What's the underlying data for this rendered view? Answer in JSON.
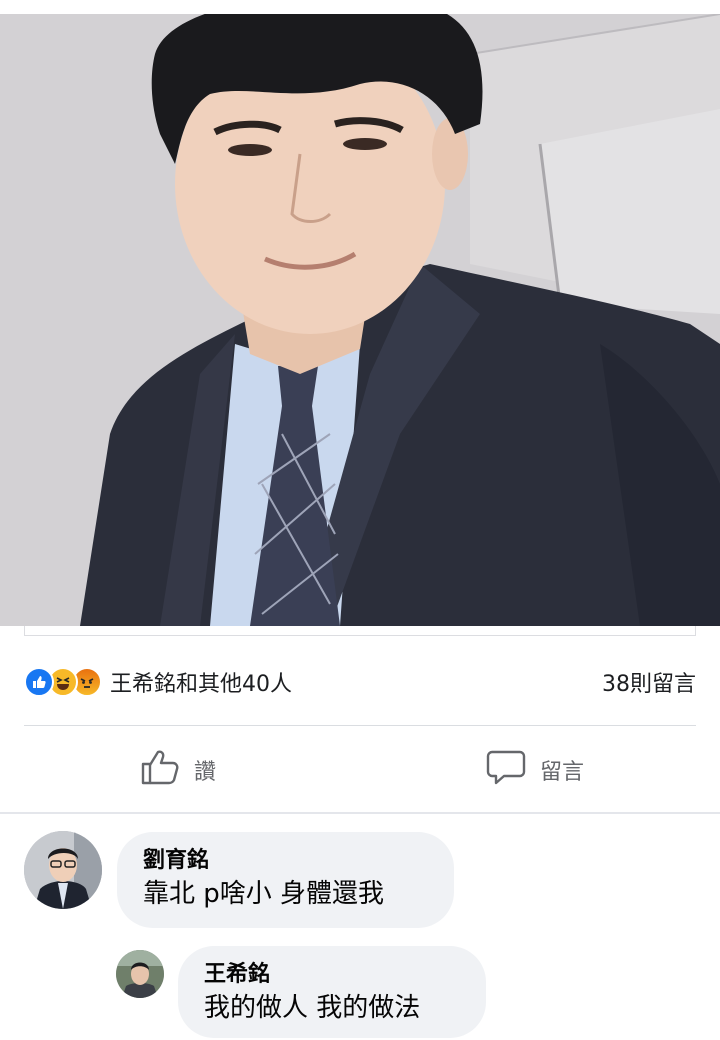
{
  "post": {
    "photo": {
      "subject": "selfie-man-in-suit"
    },
    "reactions": {
      "icons": [
        "like-icon",
        "haha-icon",
        "angry-icon"
      ],
      "summary": "王希銘和其他40人",
      "comment_count": "38則留言"
    },
    "actions": {
      "like_label": "讚",
      "comment_label": "留言"
    },
    "comments": [
      {
        "author": "劉育銘",
        "text": "靠北 p啥小 身體還我"
      },
      {
        "author": "王希銘",
        "text": "我的做人 我的做法"
      }
    ]
  },
  "colors": {
    "like_blue": "#1877f2",
    "haha_yellow": "#f7b928",
    "angry_orange": "#e9710f",
    "bubble_bg": "#f0f2f5",
    "secondary_text": "#65676b"
  }
}
